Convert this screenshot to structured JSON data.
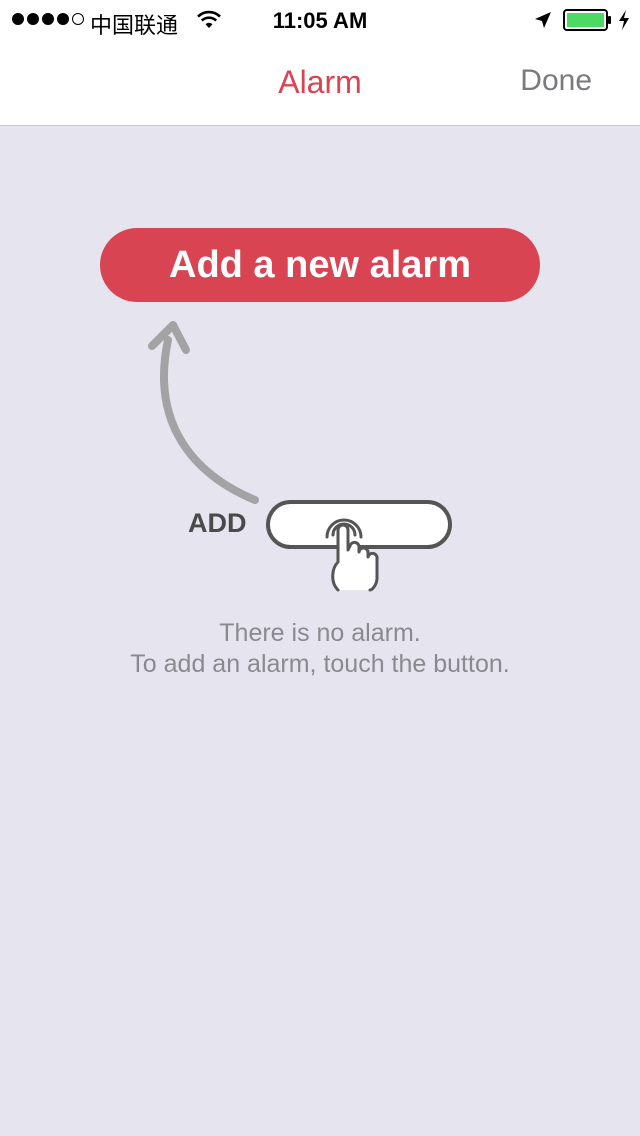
{
  "status_bar": {
    "carrier": "中国联通",
    "time": "11:05 AM",
    "signal_dots_filled": 4,
    "battery_color": "#4cd964"
  },
  "nav": {
    "title": "Alarm",
    "done_label": "Done"
  },
  "main": {
    "add_button_label": "Add a new alarm",
    "illustration_label": "ADD",
    "empty_message_line1": "There is no alarm.",
    "empty_message_line2": "To add an alarm, touch the button."
  },
  "colors": {
    "accent": "#d94452",
    "background": "#e6e4ee"
  },
  "icons": [
    "wifi-icon",
    "location-arrow-icon",
    "battery-icon",
    "charging-bolt-icon",
    "curved-arrow-icon",
    "tapping-hand-icon"
  ]
}
